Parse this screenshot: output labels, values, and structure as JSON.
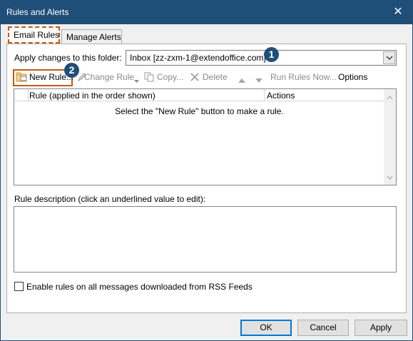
{
  "window": {
    "title": "Rules and Alerts"
  },
  "tabs": [
    {
      "label": "Email Rules",
      "active": true
    },
    {
      "label": "Manage Alerts",
      "active": false
    }
  ],
  "folder": {
    "label": "Apply changes to this folder:",
    "value": "Inbox [zz-zxm-1@extendoffice.com]"
  },
  "badges": {
    "one": "1",
    "two": "2"
  },
  "toolbar": {
    "new_rule": "New Rule...",
    "change_rule": "Change Rule",
    "copy": "Copy...",
    "delete": "Delete",
    "run_rules_now": "Run Rules Now...",
    "options": "Options"
  },
  "rules_list": {
    "columns": [
      "Rule (applied in the order shown)",
      "Actions"
    ],
    "empty_message": "Select the \"New Rule\" button to make a rule."
  },
  "description": {
    "label": "Rule description (click an underlined value to edit):"
  },
  "rss": {
    "label": "Enable rules on all messages downloaded from RSS Feeds",
    "checked": false
  },
  "buttons": {
    "ok": "OK",
    "cancel": "Cancel",
    "apply": "Apply"
  },
  "colors": {
    "titlebar": "#1f4e79",
    "highlight": "#c55a11",
    "badge": "#1f4e79"
  }
}
